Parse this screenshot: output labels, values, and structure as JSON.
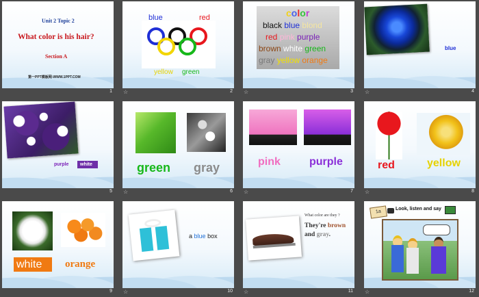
{
  "slides": [
    {
      "number": "1",
      "title_top": "Unit 2 Topic 2",
      "title_main": "What color is his hair?",
      "section": "Section A",
      "footer_text": "第一PPT模板网-WWW.1PPT.COM"
    },
    {
      "number": "2",
      "words": {
        "blue": "blue",
        "red": "red",
        "yellow": "yellow",
        "green": "green"
      }
    },
    {
      "number": "3",
      "heading": "color",
      "rows": [
        [
          "black",
          "blue",
          "blond"
        ],
        [
          "red",
          "pink",
          "purple"
        ],
        [
          "brown",
          "white",
          "green"
        ],
        [
          "gray",
          "yellow",
          "orange"
        ]
      ]
    },
    {
      "number": "4",
      "caption": "blue"
    },
    {
      "number": "5",
      "label_a": "purple",
      "label_b": "white"
    },
    {
      "number": "6",
      "left": "green",
      "right": "gray"
    },
    {
      "number": "7",
      "left": "pink",
      "right": "purple"
    },
    {
      "number": "8",
      "left": "red",
      "right": "yellow"
    },
    {
      "number": "9",
      "left": "white",
      "right": "orange"
    },
    {
      "number": "10",
      "text_a": "a",
      "text_b": "blue",
      "text_c": "box"
    },
    {
      "number": "11",
      "question": "What color are they ?",
      "answer_1": "They're",
      "answer_2": "brown",
      "answer_3": "and",
      "answer_4": "gray",
      "answer_5": "."
    },
    {
      "number": "12",
      "badge": "1a",
      "heading": "Look, listen and say"
    }
  ],
  "colors": {
    "blue": "#1f2fd6",
    "red": "#e8171d",
    "yellow": "#e6d200",
    "green": "#17b81a",
    "pink": "#f06dc0",
    "purple": "#8a2fd8",
    "gray": "#8b8b8b",
    "orange": "#f07a12",
    "brown": "#a0522d"
  }
}
